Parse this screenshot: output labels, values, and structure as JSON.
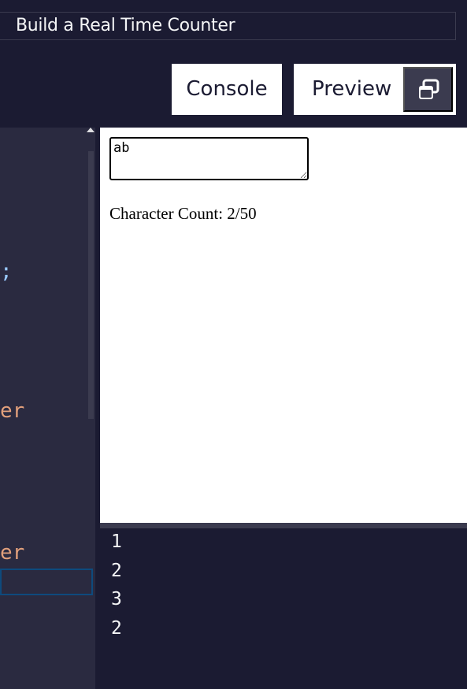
{
  "header": {
    "title": "Build a Real Time Counter"
  },
  "tabs": {
    "console_label": "Console",
    "preview_label": "Preview",
    "popout_icon": "popout-window-icon"
  },
  "editor": {
    "visible_fragments": [
      {
        "text": ";",
        "color": "#99c9ff"
      },
      {
        "text": "er",
        "color": "#e2a07c"
      },
      {
        "text": "er",
        "color": "#e2a07c"
      }
    ]
  },
  "preview": {
    "textarea_value": "ab",
    "char_count_text": "Character Count: 2/50"
  },
  "console": {
    "lines": [
      "1",
      "2",
      "3",
      "2"
    ]
  },
  "colors": {
    "background": "#1b1b32",
    "editor_bg": "#2a2a40",
    "panel_accent": "#3b3b4f",
    "highlight_border": "#0e4a7d"
  }
}
